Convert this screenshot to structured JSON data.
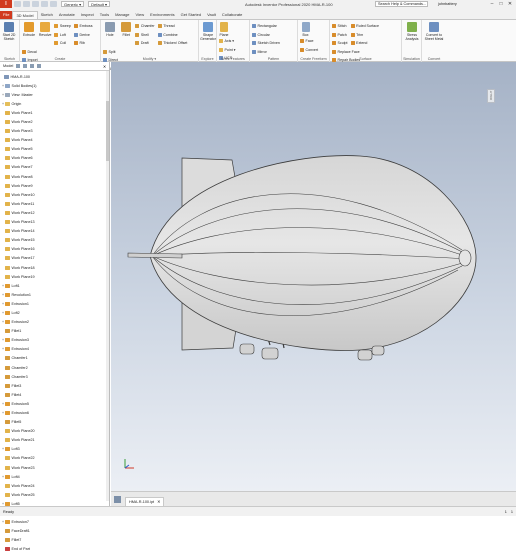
{
  "app": {
    "title": "Autodesk Inventor Professional 2020   HMA-R-100",
    "logo": "I",
    "appearance": "Generic",
    "view_style": "Default",
    "search_placeholder": "Search Help & Commands...",
    "user": "johnbattery",
    "window_min": "–",
    "window_max": "□",
    "window_close": "✕"
  },
  "tabs": [
    "File",
    "3D Model",
    "Sketch",
    "Annotate",
    "Inspect",
    "Tools",
    "Manage",
    "View",
    "Environments",
    "Get Started",
    "Vault",
    "Collaborate"
  ],
  "ribbon": {
    "sketch": {
      "label": "Sketch",
      "start": "Start 2D Sketch"
    },
    "create": {
      "label": "Create",
      "extrude": "Extrude",
      "revolve": "Revolve",
      "sweep": "Sweep",
      "loft": "Loft",
      "coil": "Coil",
      "emboss": "Emboss",
      "derive": "Derive",
      "rib": "Rib",
      "decal": "Decal",
      "import": "Import",
      "unwrap": "Unwrap"
    },
    "modify": {
      "label": "Modify ▾",
      "hole": "Hole",
      "fillet": "Fillet",
      "chamfer": "Chamfer",
      "shell": "Shell",
      "draft": "Draft",
      "thread": "Thread",
      "combine": "Combine",
      "thicken": "Thicken/ Offset",
      "split": "Split",
      "direct": "Direct",
      "delete_face": "Delete Face"
    },
    "explore": {
      "label": "Explore",
      "shape_generator": "Shape Generator"
    },
    "work_features": {
      "label": "Work Features",
      "plane": "Plane",
      "axis": "Axis ▾",
      "point": "Point ▾",
      "ucs": "UCS"
    },
    "pattern": {
      "label": "Pattern",
      "rectangular": "Rectangular",
      "mirror": "Mirror",
      "circular": "Circular",
      "sketch_driven": "Sketch Driven"
    },
    "freeform": {
      "label": "Create Freeform",
      "box": "Box",
      "face": "Face",
      "convert": "Convert"
    },
    "surface": {
      "label": "Surface",
      "stitch": "Stitch",
      "patch": "Patch",
      "sculpt": "Sculpt",
      "ruled": "Ruled Surface",
      "trim": "Trim",
      "extend": "Extend",
      "replace": "Replace Face",
      "repair": "Repair Bodies",
      "fit_mesh": "Fit Mesh Face"
    },
    "simulation": {
      "label": "Simulation",
      "stress": "Stress Analysis"
    },
    "convert": {
      "label": "Convert",
      "sheet_metal": "Convert to Sheet Metal"
    }
  },
  "browser": {
    "model_tab": "Model",
    "close": "✕",
    "items": [
      {
        "label": "HMA-R-100",
        "exp": "",
        "icon": "part-icon"
      },
      {
        "label": "Solid Bodies(1)",
        "exp": "+",
        "icon": "solid-bodies-icon"
      },
      {
        "label": "View: Master",
        "exp": "+",
        "icon": "view-icon"
      },
      {
        "label": "Origin",
        "exp": "+",
        "icon": "folder-icon"
      },
      {
        "label": "Work Plane1",
        "exp": "",
        "icon": "work-plane-icon"
      },
      {
        "label": "Work Plane2",
        "exp": "",
        "icon": "work-plane-icon"
      },
      {
        "label": "Work Plane3",
        "exp": "",
        "icon": "work-plane-icon"
      },
      {
        "label": "Work Plane4",
        "exp": "",
        "icon": "work-plane-icon"
      },
      {
        "label": "Work Plane5",
        "exp": "",
        "icon": "work-plane-icon"
      },
      {
        "label": "Work Plane6",
        "exp": "",
        "icon": "work-plane-icon"
      },
      {
        "label": "Work Plane7",
        "exp": "",
        "icon": "work-plane-icon"
      },
      {
        "label": "Work Plane8",
        "exp": "",
        "icon": "work-plane-icon"
      },
      {
        "label": "Work Plane9",
        "exp": "",
        "icon": "work-plane-icon"
      },
      {
        "label": "Work Plane10",
        "exp": "",
        "icon": "work-plane-icon"
      },
      {
        "label": "Work Plane11",
        "exp": "",
        "icon": "work-plane-icon"
      },
      {
        "label": "Work Plane12",
        "exp": "",
        "icon": "work-plane-icon"
      },
      {
        "label": "Work Plane13",
        "exp": "",
        "icon": "work-plane-icon"
      },
      {
        "label": "Work Plane14",
        "exp": "",
        "icon": "work-plane-icon"
      },
      {
        "label": "Work Plane15",
        "exp": "",
        "icon": "work-plane-icon"
      },
      {
        "label": "Work Plane16",
        "exp": "",
        "icon": "work-plane-icon"
      },
      {
        "label": "Work Plane17",
        "exp": "",
        "icon": "work-plane-icon"
      },
      {
        "label": "Work Plane18",
        "exp": "",
        "icon": "work-plane-icon"
      },
      {
        "label": "Work Plane19",
        "exp": "",
        "icon": "work-plane-icon"
      },
      {
        "label": "Loft1",
        "exp": "+",
        "icon": "loft-icon"
      },
      {
        "label": "Revolution1",
        "exp": "+",
        "icon": "revolve-icon"
      },
      {
        "label": "Extrusion1",
        "exp": "+",
        "icon": "extrude-icon"
      },
      {
        "label": "Loft2",
        "exp": "+",
        "icon": "loft-icon"
      },
      {
        "label": "Extrusion2",
        "exp": "+",
        "icon": "extrude-icon"
      },
      {
        "label": "Fillet1",
        "exp": "",
        "icon": "fillet-icon"
      },
      {
        "label": "Extrusion3",
        "exp": "+",
        "icon": "extrude-icon"
      },
      {
        "label": "Extrusion4",
        "exp": "+",
        "icon": "extrude-icon"
      },
      {
        "label": "Chamfer1",
        "exp": "",
        "icon": "chamfer-icon"
      },
      {
        "label": "Chamfer2",
        "exp": "",
        "icon": "chamfer-icon"
      },
      {
        "label": "Chamfer3",
        "exp": "",
        "icon": "chamfer-icon"
      },
      {
        "label": "Fillet3",
        "exp": "",
        "icon": "fillet-icon"
      },
      {
        "label": "Fillet4",
        "exp": "",
        "icon": "fillet-icon"
      },
      {
        "label": "Extrusion5",
        "exp": "+",
        "icon": "extrude-icon"
      },
      {
        "label": "Extrusion6",
        "exp": "+",
        "icon": "extrude-icon"
      },
      {
        "label": "Fillet5",
        "exp": "",
        "icon": "fillet-icon"
      },
      {
        "label": "Work Plane20",
        "exp": "",
        "icon": "work-plane-icon"
      },
      {
        "label": "Work Plane21",
        "exp": "",
        "icon": "work-plane-icon"
      },
      {
        "label": "Loft3",
        "exp": "+",
        "icon": "loft-icon"
      },
      {
        "label": "Work Plane22",
        "exp": "",
        "icon": "work-plane-icon"
      },
      {
        "label": "Work Plane23",
        "exp": "",
        "icon": "work-plane-icon"
      },
      {
        "label": "Loft4",
        "exp": "+",
        "icon": "loft-icon"
      },
      {
        "label": "Work Plane24",
        "exp": "",
        "icon": "work-plane-icon"
      },
      {
        "label": "Work Plane25",
        "exp": "",
        "icon": "work-plane-icon"
      },
      {
        "label": "Loft5",
        "exp": "+",
        "icon": "loft-icon"
      },
      {
        "label": "Mirror1",
        "exp": "+",
        "icon": "mirror-icon"
      },
      {
        "label": "Extrusion7",
        "exp": "+",
        "icon": "extrude-icon"
      },
      {
        "label": "FaceDraft1",
        "exp": "",
        "icon": "draft-icon"
      },
      {
        "label": "Fillet7",
        "exp": "",
        "icon": "fillet-icon"
      },
      {
        "label": "End of Part",
        "exp": "",
        "icon": "end-of-part-icon"
      }
    ]
  },
  "document_tab": {
    "label": "HMA-R-100.ipt",
    "close": "✕"
  },
  "viewcube": {
    "face": "RIGHT"
  },
  "status": {
    "text": "Ready",
    "count1": "1",
    "count2": "1"
  },
  "colors": {
    "accent": "#d13a1f",
    "viewport_top": "#a5b2c6",
    "viewport_bottom": "#eef1f6",
    "model_fill": "#e2e2e2",
    "model_edge": "#3c3c3c"
  }
}
